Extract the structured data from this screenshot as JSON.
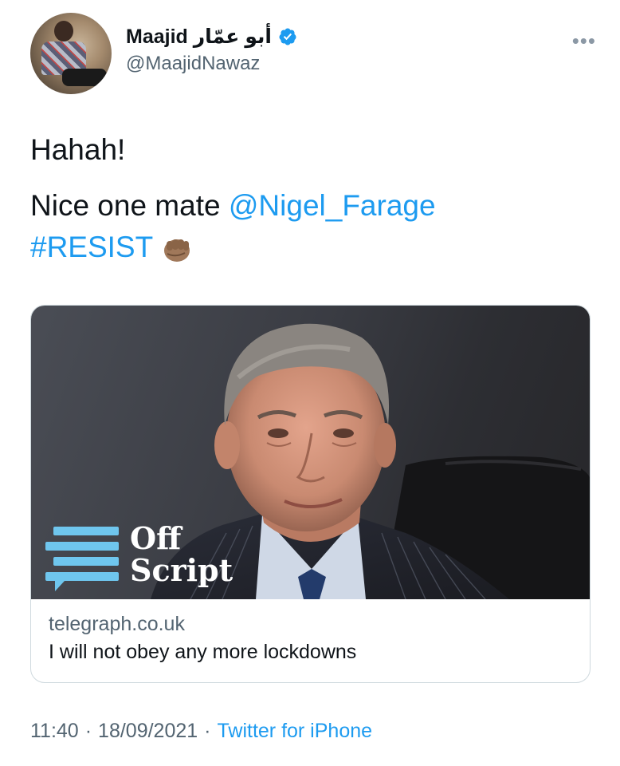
{
  "tweet": {
    "display_name": "Maajid أبو عمّار",
    "handle": "@MaajidNawaz",
    "more_icon": "more-dots-icon",
    "text_line1": "Hahah!",
    "text_line2_prefix": "Nice one mate ",
    "mention": "@Nigel_Farage",
    "hashtag": "#RESIST",
    "emoji": "fist-icon"
  },
  "card": {
    "logo_word1": "Off",
    "logo_word2": "Script",
    "domain": "telegraph.co.uk",
    "title": "I will not obey any more lockdowns"
  },
  "footer": {
    "time": "11:40",
    "date": "18/09/2021",
    "source": "Twitter for iPhone",
    "separator": "·"
  },
  "colors": {
    "link": "#1d9bf0",
    "muted": "#536471",
    "logo_blue": "#6fc6ee"
  }
}
